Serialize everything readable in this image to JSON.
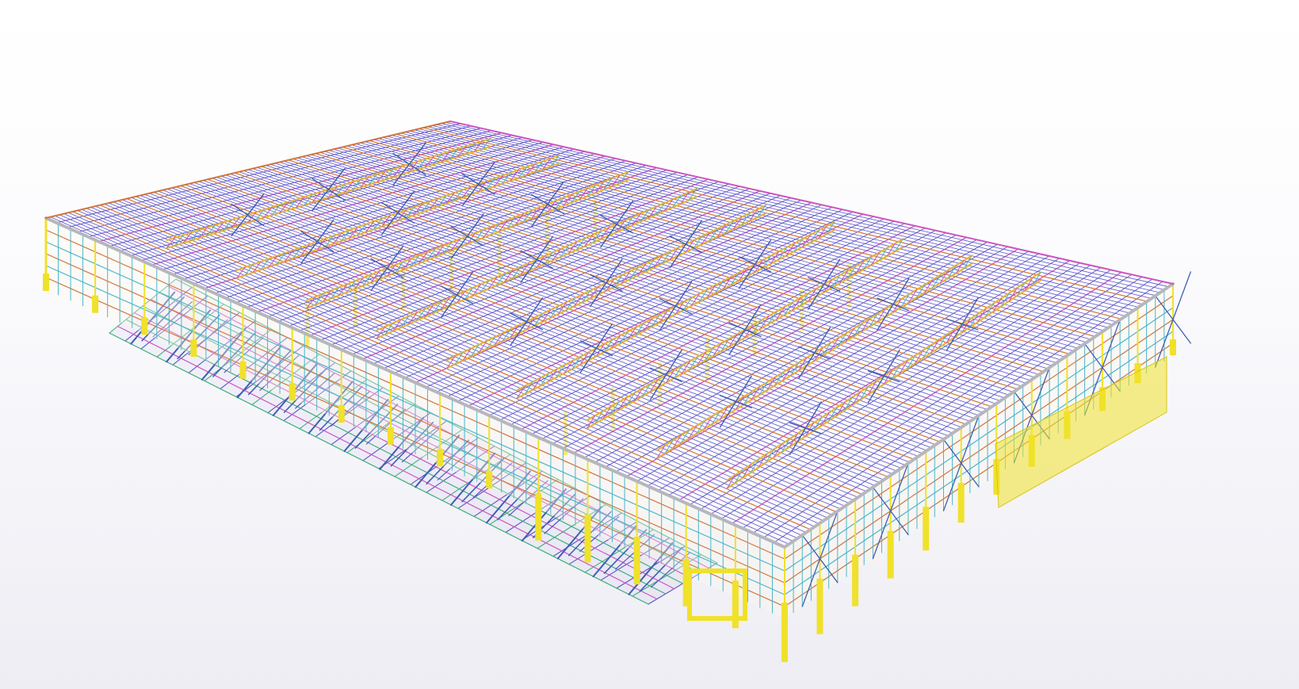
{
  "viewport": {
    "background_top": "#ffffff",
    "background_bottom": "#ededf3"
  },
  "model": {
    "description_icon": "steel-frame-warehouse-3d-model",
    "colors": {
      "column": "#f0e12a",
      "column_dark": "#d9c514",
      "roof_purlin": "#5b53c8",
      "roof_rafter": "#cc55c0",
      "truss_chord": "#e8b43a",
      "truss_web": "#4cb6c9",
      "bracing": "#3f5fb3",
      "eave_beam": "#b6b6bc",
      "girt": "#d2743a",
      "canopy_green": "#3fae7a"
    }
  }
}
